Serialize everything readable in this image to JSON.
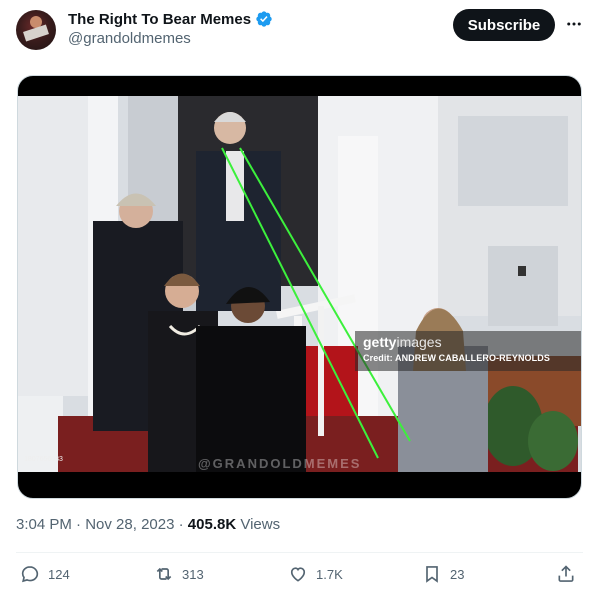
{
  "author": {
    "display_name": "The Right To Bear Memes",
    "handle": "@grandoldmemes",
    "avatar_icon": "profile-avatar",
    "verified_icon": "verified-badge-icon",
    "verified_color": "#1d9bf0"
  },
  "header": {
    "subscribe_label": "Subscribe",
    "more_icon": "more-dots-icon"
  },
  "media": {
    "getty_brand": "getty",
    "getty_brand_suffix": "images",
    "getty_credit": "Credit: ANDREW CABALLERO-REYNOLDS",
    "photo_id": "1807656033",
    "watermark": "@GRANDOLDMEMES",
    "annotation_color": "#3cf03c"
  },
  "meta": {
    "time": "3:04 PM",
    "separator": " · ",
    "date": "Nov 28, 2023",
    "separator2": " · ",
    "views_count": "405.8K",
    "views_label": " Views"
  },
  "actions": {
    "replies": "124",
    "reposts": "313",
    "likes": "1.7K",
    "bookmarks": "23",
    "icons": [
      "reply-icon",
      "repost-icon",
      "like-icon",
      "bookmark-icon",
      "share-icon"
    ]
  },
  "colors": {
    "text_primary": "#0f1419",
    "text_secondary": "#536471",
    "subscribe_bg": "#0f1419"
  }
}
